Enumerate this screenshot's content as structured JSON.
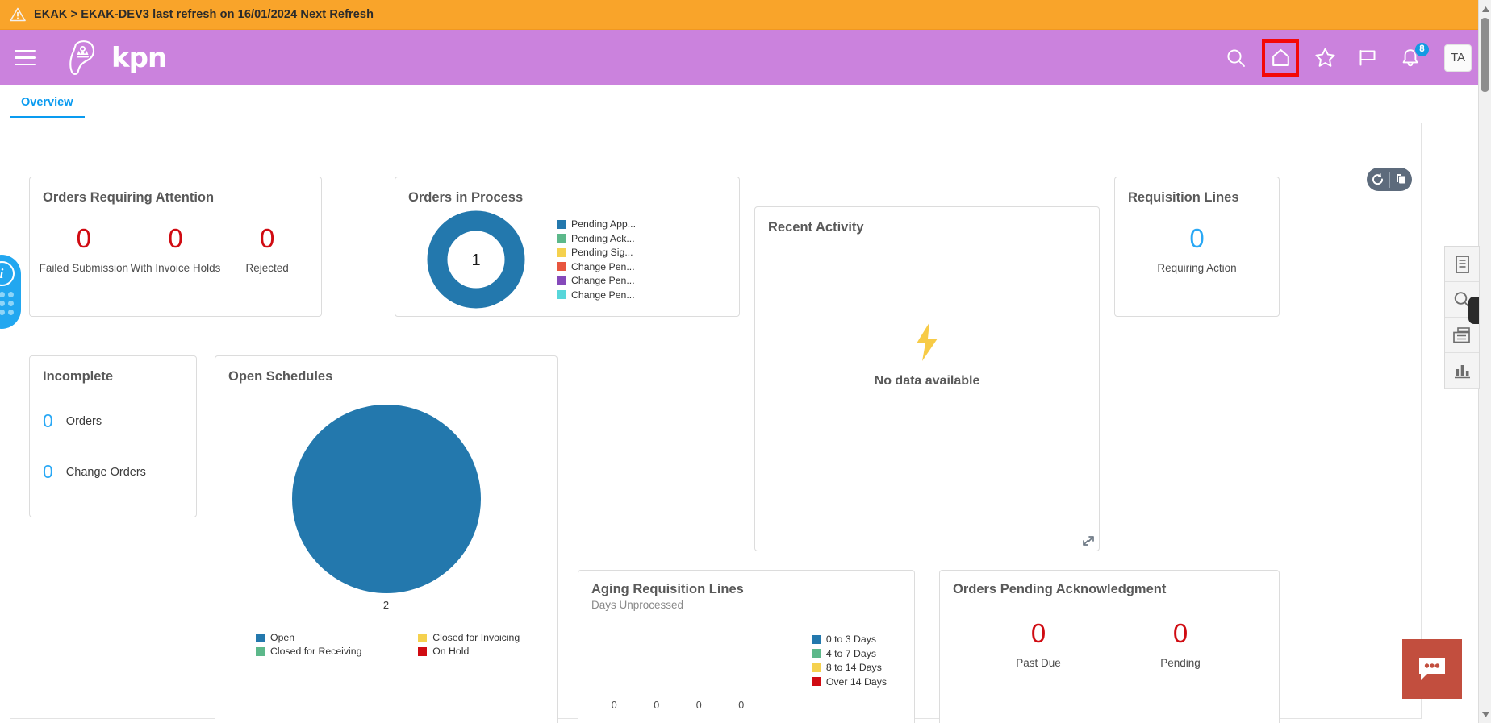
{
  "alert": {
    "icon": "warning-triangle-icon",
    "text": "EKAK > EKAK-DEV3 last refresh on 16/01/2024 Next Refresh"
  },
  "header": {
    "menu_icon": "hamburger-menu-icon",
    "logo_text": "kpn",
    "icons": [
      {
        "name": "search-icon",
        "label": "Search"
      },
      {
        "name": "home-icon",
        "label": "Home"
      },
      {
        "name": "star-icon",
        "label": "Favorites"
      },
      {
        "name": "flag-icon",
        "label": "Flag"
      },
      {
        "name": "bell-icon",
        "label": "Notifications"
      }
    ],
    "notification_count": "8",
    "avatar_initials": "TA",
    "highlight_color": "#f40808",
    "bar_color": "#cb82dd"
  },
  "tabs": [
    {
      "label": "Overview",
      "active": true
    }
  ],
  "toolbar": {
    "refresh_icon": "refresh-icon",
    "copy_icon": "copy-layers-icon"
  },
  "cards": {
    "orders_requiring_attention": {
      "title": "Orders Requiring Attention",
      "kpis": [
        {
          "value": "0",
          "label": "Failed Submission"
        },
        {
          "value": "0",
          "label": "With Invoice Holds"
        },
        {
          "value": "0",
          "label": "Rejected"
        }
      ]
    },
    "orders_in_process": {
      "title": "Orders in Process",
      "center_value": "1"
    },
    "recent_activity": {
      "title": "Recent Activity",
      "empty_icon": "lightning-bolt-icon",
      "empty_text": "No data available"
    },
    "requisition_lines": {
      "title": "Requisition Lines",
      "value": "0",
      "label": "Requiring Action"
    },
    "incomplete": {
      "title": "Incomplete",
      "rows": [
        {
          "value": "0",
          "label": "Orders"
        },
        {
          "value": "0",
          "label": "Change Orders"
        }
      ]
    },
    "open_schedules": {
      "title": "Open Schedules",
      "data_label": "2"
    },
    "aging_requisition_lines": {
      "title": "Aging Requisition Lines",
      "subtitle": "Days Unprocessed"
    },
    "orders_pending_acknowledgment": {
      "title": "Orders Pending Acknowledgment",
      "kpis": [
        {
          "value": "0",
          "label": "Past Due"
        },
        {
          "value": "0",
          "label": "Pending"
        }
      ]
    }
  },
  "chart_data": [
    {
      "type": "pie",
      "title": "Orders in Process",
      "variant": "donut",
      "center_label": "1",
      "legend_position": "right",
      "labels": [
        "Pending App...",
        "Pending Ack...",
        "Pending Sig...",
        "Change Pen...",
        "Change Pen...",
        "Change Pen..."
      ],
      "values": [
        1,
        0,
        0,
        0,
        0,
        0
      ],
      "colors": [
        "#2378ad",
        "#5cb88a",
        "#f5d14e",
        "#e8563f",
        "#8549ba",
        "#57d6da"
      ]
    },
    {
      "type": "pie",
      "title": "Open Schedules",
      "labels": [
        "Open",
        "Closed for Invoicing",
        "Closed for Receiving",
        "On Hold"
      ],
      "values": [
        2,
        0,
        0,
        0
      ],
      "data_labels": [
        "2"
      ],
      "colors": [
        "#2378ad",
        "#f5d14e",
        "#5cb88a",
        "#d00b12"
      ],
      "legend_position": "bottom"
    },
    {
      "type": "bar",
      "title": "Aging Requisition Lines",
      "subtitle": "Days Unprocessed",
      "xlabel": "",
      "ylabel": "",
      "categories": [
        "0 to 3 Days",
        "4 to 7 Days",
        "8 to 14 Days",
        "Over 14 Days"
      ],
      "values": [
        0,
        0,
        0,
        0
      ],
      "value_labels": [
        "0",
        "0",
        "0",
        "0"
      ],
      "colors": [
        "#2378ad",
        "#5cb88a",
        "#f5d14e",
        "#d00b12"
      ],
      "legend_position": "right",
      "grid": false
    }
  ],
  "right_rail": {
    "items": [
      {
        "name": "document-icon"
      },
      {
        "name": "search-page-icon"
      },
      {
        "name": "list-panel-icon"
      },
      {
        "name": "bar-chart-icon"
      }
    ],
    "info_badge": "i",
    "accent_color": "#22a7f0"
  },
  "chat": {
    "icon": "chat-bubble-icon",
    "color": "#c24e3e"
  }
}
